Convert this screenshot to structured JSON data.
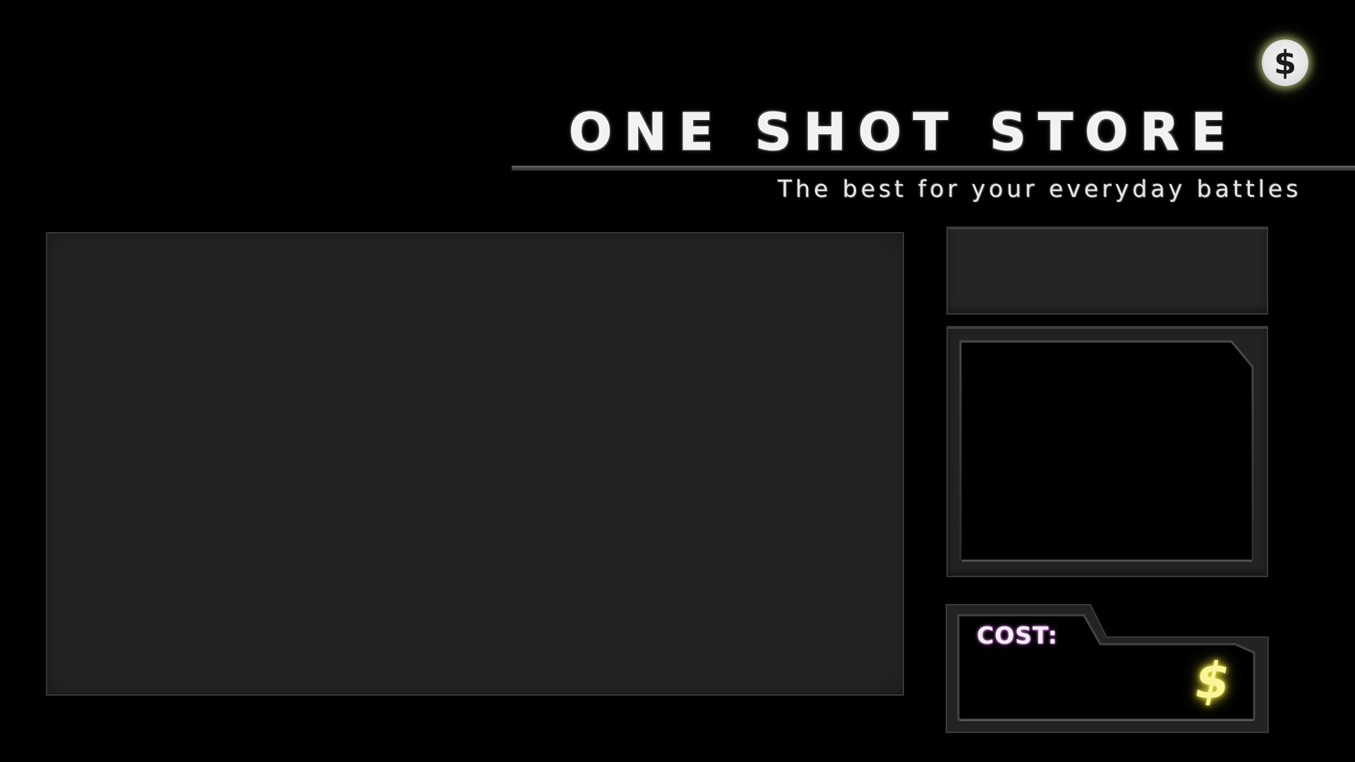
{
  "header": {
    "currency_icon": "dollar-coin-icon",
    "currency_glyph": "$",
    "title": "ONE SHOT STORE",
    "tagline": "The best for your everyday battles"
  },
  "cost_panel": {
    "label": "COST:",
    "currency_icon": "dollar-icon",
    "currency_glyph": "$"
  },
  "colors": {
    "background": "#000000",
    "panel": "#232323",
    "panel_border": "#3a3a3a",
    "cost_label_glow": "#a04fb3",
    "currency_glow": "#e3df3a"
  }
}
